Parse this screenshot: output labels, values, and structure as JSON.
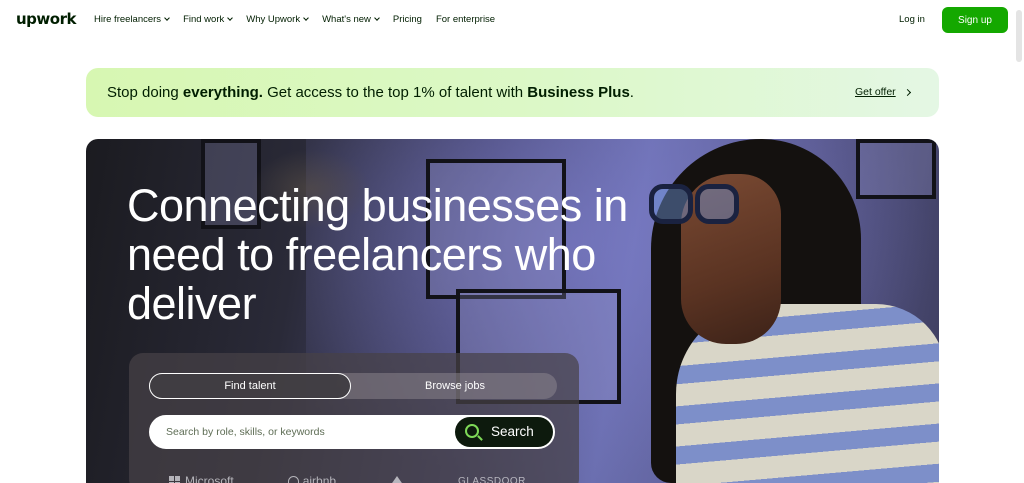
{
  "header": {
    "logo": "upwork",
    "nav": [
      {
        "label": "Hire freelancers",
        "dropdown": true
      },
      {
        "label": "Find work",
        "dropdown": true
      },
      {
        "label": "Why Upwork",
        "dropdown": true
      },
      {
        "label": "What's new",
        "dropdown": true
      },
      {
        "label": "Pricing",
        "dropdown": false
      },
      {
        "label": "For enterprise",
        "dropdown": false
      }
    ],
    "login": "Log in",
    "signup": "Sign up"
  },
  "promo": {
    "text_pre": "Stop doing ",
    "text_bold1": "everything.",
    "text_mid": " Get access to the top 1% of talent with ",
    "text_bold2": "Business Plus",
    "text_post": ".",
    "link": "Get offer"
  },
  "hero": {
    "title": "Connecting businesses in need to freelancers who deliver"
  },
  "search": {
    "tabs": [
      {
        "label": "Find talent",
        "active": true
      },
      {
        "label": "Browse jobs",
        "active": false
      }
    ],
    "placeholder": "Search by role, skills, or keywords",
    "button": "Search"
  },
  "clients": [
    "Microsoft",
    "airbnb",
    "",
    "GLASSDOOR"
  ],
  "colors": {
    "brand_green": "#14a800",
    "text_dark": "#001e00",
    "promo_bg": "#d7f7b2",
    "search_icon": "#7ed957"
  }
}
